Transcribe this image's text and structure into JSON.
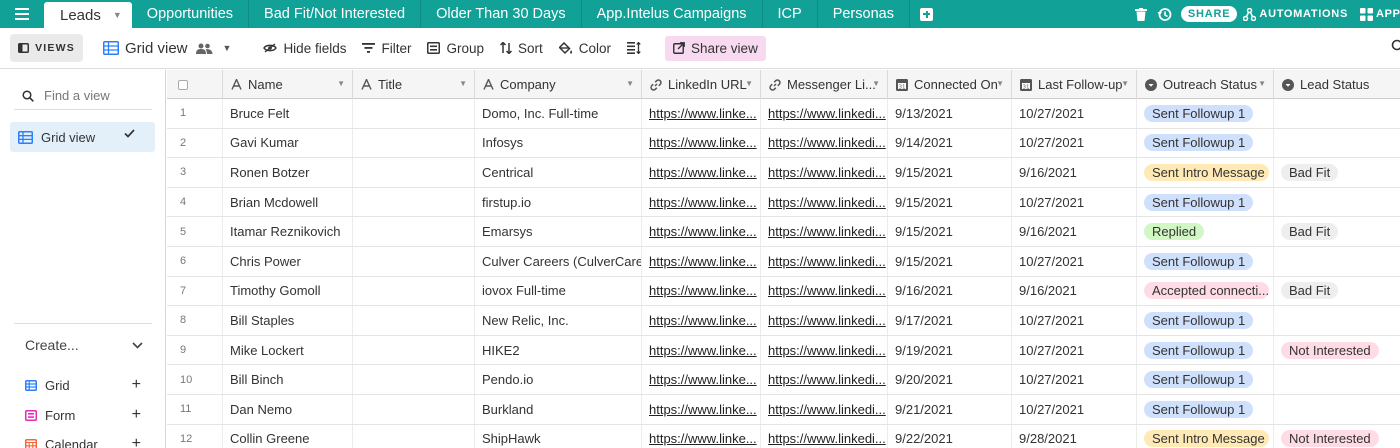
{
  "colors": {
    "brand": "#12a197",
    "share_view_bg": "#f7d9f0",
    "selected_view_bg": "#e3f0fa",
    "status_sent_followup": "#cfe0fc",
    "status_sent_intro": "#ffeab6",
    "status_replied": "#d1f7c4",
    "status_accepted": "#ffdce5",
    "status_bad_fit": "#eeeeee",
    "status_not_interested": "#ffdce5"
  },
  "tabs": [
    {
      "label": "Leads",
      "active": true
    },
    {
      "label": "Opportunities"
    },
    {
      "label": "Bad Fit/Not Interested"
    },
    {
      "label": "Older Than 30 Days"
    },
    {
      "label": "App.Intelus Campaigns"
    },
    {
      "label": "ICP"
    },
    {
      "label": "Personas"
    }
  ],
  "topbar": {
    "share_label": "SHARE",
    "automations_label": "AUTOMATIONS",
    "apps_label": "APPS",
    "icons": [
      "menu-icon",
      "trash-icon",
      "history-icon",
      "automations-icon",
      "apps-icon"
    ]
  },
  "toolbar": {
    "views_label": "VIEWS",
    "grid_view_label": "Grid view",
    "hide_fields_label": "Hide fields",
    "filter_label": "Filter",
    "group_label": "Group",
    "sort_label": "Sort",
    "color_label": "Color",
    "share_view_label": "Share view"
  },
  "sidebar": {
    "find_placeholder": "Find a view",
    "views": [
      {
        "label": "Grid view",
        "selected": true
      }
    ],
    "create_label": "Create...",
    "create_items": [
      {
        "label": "Grid",
        "icon": "grid-icon",
        "color": "#2d7ff9"
      },
      {
        "label": "Form",
        "icon": "form-icon",
        "color": "#e929ba"
      },
      {
        "label": "Calendar",
        "icon": "calendar-icon",
        "color": "#f7653b"
      }
    ]
  },
  "grid": {
    "columns": [
      {
        "label": "Name",
        "type": "text"
      },
      {
        "label": "Title",
        "type": "text"
      },
      {
        "label": "Company",
        "type": "text"
      },
      {
        "label": "LinkedIn URL",
        "type": "url"
      },
      {
        "label": "Messenger Li...",
        "type": "url"
      },
      {
        "label": "Connected On",
        "type": "date"
      },
      {
        "label": "Last Follow-up",
        "type": "date"
      },
      {
        "label": "Outreach Status",
        "type": "select"
      },
      {
        "label": "Lead Status",
        "type": "select"
      }
    ],
    "rows": [
      {
        "num": "1",
        "name": "Bruce Felt",
        "title": "",
        "company": "Domo, Inc. Full-time",
        "linkedin": "https://www.linke...",
        "messenger": "https://www.linkedi...",
        "connected": "9/13/2021",
        "followup": "10/27/2021",
        "outreach": "Sent Followup 1",
        "outreach_color": "#cfe0fc",
        "lead": "",
        "lead_color": ""
      },
      {
        "num": "2",
        "name": "Gavi Kumar",
        "title": "",
        "company": "Infosys",
        "linkedin": "https://www.linke...",
        "messenger": "https://www.linkedi...",
        "connected": "9/14/2021",
        "followup": "10/27/2021",
        "outreach": "Sent Followup 1",
        "outreach_color": "#cfe0fc",
        "lead": "",
        "lead_color": ""
      },
      {
        "num": "3",
        "name": "Ronen Botzer",
        "title": "",
        "company": "Centrical",
        "linkedin": "https://www.linke...",
        "messenger": "https://www.linkedi...",
        "connected": "9/15/2021",
        "followup": "9/16/2021",
        "outreach": "Sent Intro Message",
        "outreach_color": "#ffeab6",
        "lead": "Bad Fit",
        "lead_color": "#eeeeee"
      },
      {
        "num": "4",
        "name": "Brian Mcdowell",
        "title": "",
        "company": "firstup.io",
        "linkedin": "https://www.linke...",
        "messenger": "https://www.linkedi...",
        "connected": "9/15/2021",
        "followup": "10/27/2021",
        "outreach": "Sent Followup 1",
        "outreach_color": "#cfe0fc",
        "lead": "",
        "lead_color": ""
      },
      {
        "num": "5",
        "name": "Itamar Reznikovich",
        "title": "",
        "company": "Emarsys",
        "linkedin": "https://www.linke...",
        "messenger": "https://www.linkedi...",
        "connected": "9/15/2021",
        "followup": "9/16/2021",
        "outreach": "Replied",
        "outreach_color": "#d1f7c4",
        "lead": "Bad Fit",
        "lead_color": "#eeeeee"
      },
      {
        "num": "6",
        "name": "Chris Power",
        "title": "",
        "company": "Culver Careers (CulverCare...",
        "linkedin": "https://www.linke...",
        "messenger": "https://www.linkedi...",
        "connected": "9/15/2021",
        "followup": "10/27/2021",
        "outreach": "Sent Followup 1",
        "outreach_color": "#cfe0fc",
        "lead": "",
        "lead_color": ""
      },
      {
        "num": "7",
        "name": "Timothy Gomoll",
        "title": "",
        "company": "iovox Full-time",
        "linkedin": "https://www.linke...",
        "messenger": "https://www.linkedi...",
        "connected": "9/16/2021",
        "followup": "9/16/2021",
        "outreach": "Accepted connecti...",
        "outreach_color": "#ffdce5",
        "lead": "Bad Fit",
        "lead_color": "#eeeeee"
      },
      {
        "num": "8",
        "name": "Bill Staples",
        "title": "",
        "company": "New Relic, Inc.",
        "linkedin": "https://www.linke...",
        "messenger": "https://www.linkedi...",
        "connected": "9/17/2021",
        "followup": "10/27/2021",
        "outreach": "Sent Followup 1",
        "outreach_color": "#cfe0fc",
        "lead": "",
        "lead_color": ""
      },
      {
        "num": "9",
        "name": "Mike Lockert",
        "title": "",
        "company": "HIKE2",
        "linkedin": "https://www.linke...",
        "messenger": "https://www.linkedi...",
        "connected": "9/19/2021",
        "followup": "10/27/2021",
        "outreach": "Sent Followup 1",
        "outreach_color": "#cfe0fc",
        "lead": "Not Interested",
        "lead_color": "#ffdce5"
      },
      {
        "num": "10",
        "name": "Bill Binch",
        "title": "",
        "company": "Pendo.io",
        "linkedin": "https://www.linke...",
        "messenger": "https://www.linkedi...",
        "connected": "9/20/2021",
        "followup": "10/27/2021",
        "outreach": "Sent Followup 1",
        "outreach_color": "#cfe0fc",
        "lead": "",
        "lead_color": ""
      },
      {
        "num": "11",
        "name": "Dan Nemo",
        "title": "",
        "company": "Burkland",
        "linkedin": "https://www.linke...",
        "messenger": "https://www.linkedi...",
        "connected": "9/21/2021",
        "followup": "10/27/2021",
        "outreach": "Sent Followup 1",
        "outreach_color": "#cfe0fc",
        "lead": "",
        "lead_color": ""
      },
      {
        "num": "12",
        "name": "Collin Greene",
        "title": "",
        "company": "ShipHawk",
        "linkedin": "https://www.linke...",
        "messenger": "https://www.linkedi...",
        "connected": "9/22/2021",
        "followup": "9/28/2021",
        "outreach": "Sent Intro Message",
        "outreach_color": "#ffeab6",
        "lead": "Not Interested",
        "lead_color": "#ffdce5"
      }
    ]
  }
}
